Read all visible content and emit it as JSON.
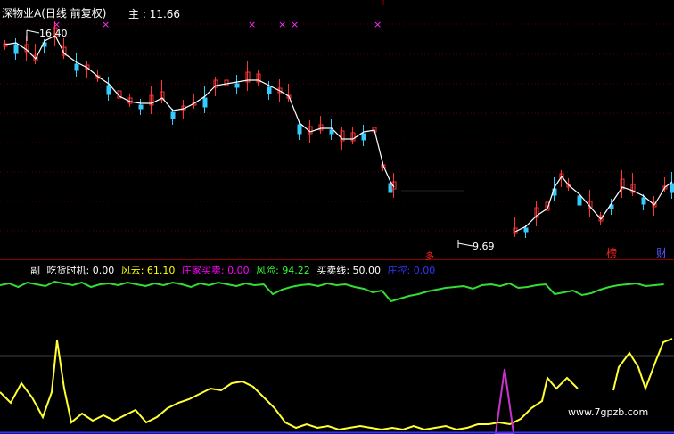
{
  "main_panel": {
    "title": "深物业A(日线 前复权)",
    "zhu_label": "主",
    "zhu_value": "11.66",
    "high_marker": "16.40",
    "low_marker": "9.69",
    "signal_markers": [
      "×",
      "×",
      "×",
      "×",
      "×",
      "×"
    ],
    "bottom_labels": {
      "left": "多",
      "middle": "榜",
      "right": "财"
    }
  },
  "sub_panel": {
    "prefix": "副",
    "indicators": [
      {
        "name": "吃货时机",
        "value": "0.00",
        "color": "#ffffff"
      },
      {
        "name": "风云",
        "value": "61.10",
        "color": "#ffff00"
      },
      {
        "name": "庄家买卖",
        "value": "0.00",
        "color": "#ff00ff"
      },
      {
        "name": "风险",
        "value": "94.22",
        "color": "#33ff33"
      },
      {
        "name": "买卖线",
        "value": "50.00",
        "color": "#ffffff"
      },
      {
        "name": "庄控",
        "value": "0.00",
        "color": "#3333ff"
      }
    ]
  },
  "watermark": "www.7gpzb.com",
  "colors": {
    "up": "#ff3333",
    "down": "#33ccff",
    "ma": "#ffffff",
    "risk_line": "#33dd33",
    "fengyun": "#ffff33",
    "zhuang": "#cc33cc",
    "mid_line": "#ffffff"
  }
}
